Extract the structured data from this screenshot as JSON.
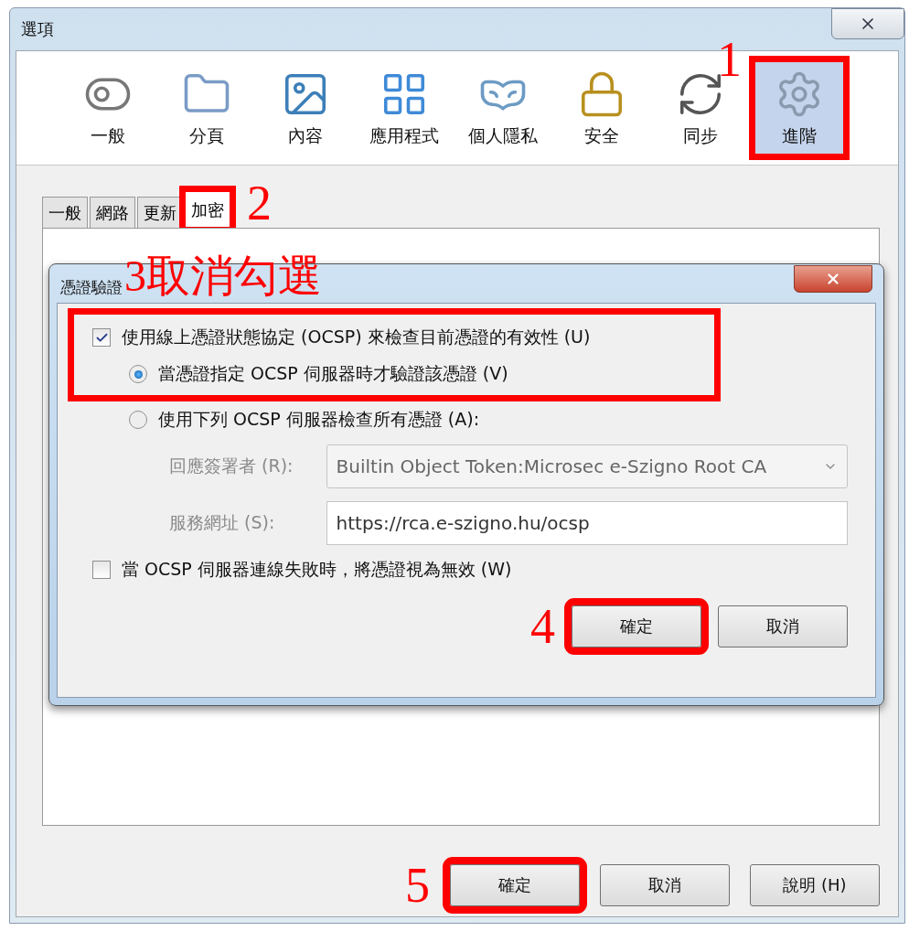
{
  "window": {
    "title": "選項"
  },
  "panes": [
    {
      "label": "一般",
      "selected": false
    },
    {
      "label": "分頁",
      "selected": false
    },
    {
      "label": "內容",
      "selected": false
    },
    {
      "label": "應用程式",
      "selected": false
    },
    {
      "label": "個人隱私",
      "selected": false
    },
    {
      "label": "安全",
      "selected": false
    },
    {
      "label": "同步",
      "selected": false
    },
    {
      "label": "進階",
      "selected": true,
      "callout": "1"
    }
  ],
  "tabs": [
    {
      "label": "一般",
      "selected": false
    },
    {
      "label": "網路",
      "selected": false
    },
    {
      "label": "更新",
      "selected": false
    },
    {
      "label": "加密",
      "selected": true,
      "callout": "2"
    }
  ],
  "dialog": {
    "title": "憑證驗證",
    "callout": "3取消勾選",
    "ocsp_check": {
      "label": "使用線上憑證狀態協定 (OCSP) 來檢查目前憑證的有效性 (U)",
      "checked": true
    },
    "radios": [
      {
        "label": "當憑證指定 OCSP 伺服器時才驗證該憑證 (V)",
        "selected": true
      },
      {
        "label": "使用下列 OCSP 伺服器檢查所有憑證 (A):",
        "selected": false
      }
    ],
    "fields": [
      {
        "kind": "dropdown",
        "label": "回應簽署者 (R):",
        "value": "Builtin Object Token:Microsec e-Szigno Root CA",
        "disabled": true
      },
      {
        "kind": "text",
        "label": "服務網址 (S):",
        "value": "https://rca.e-szigno.hu/ocsp",
        "disabled": true
      }
    ],
    "fail_check": {
      "label": "當 OCSP 伺服器連線失敗時，將憑證視為無效 (W)",
      "checked": false
    },
    "buttons": [
      {
        "label": "確定",
        "callout": "4"
      },
      {
        "label": "取消"
      }
    ]
  },
  "buttons": [
    {
      "label": "確定",
      "callout": "5"
    },
    {
      "label": "取消"
    },
    {
      "label": "說明 (H)"
    }
  ]
}
